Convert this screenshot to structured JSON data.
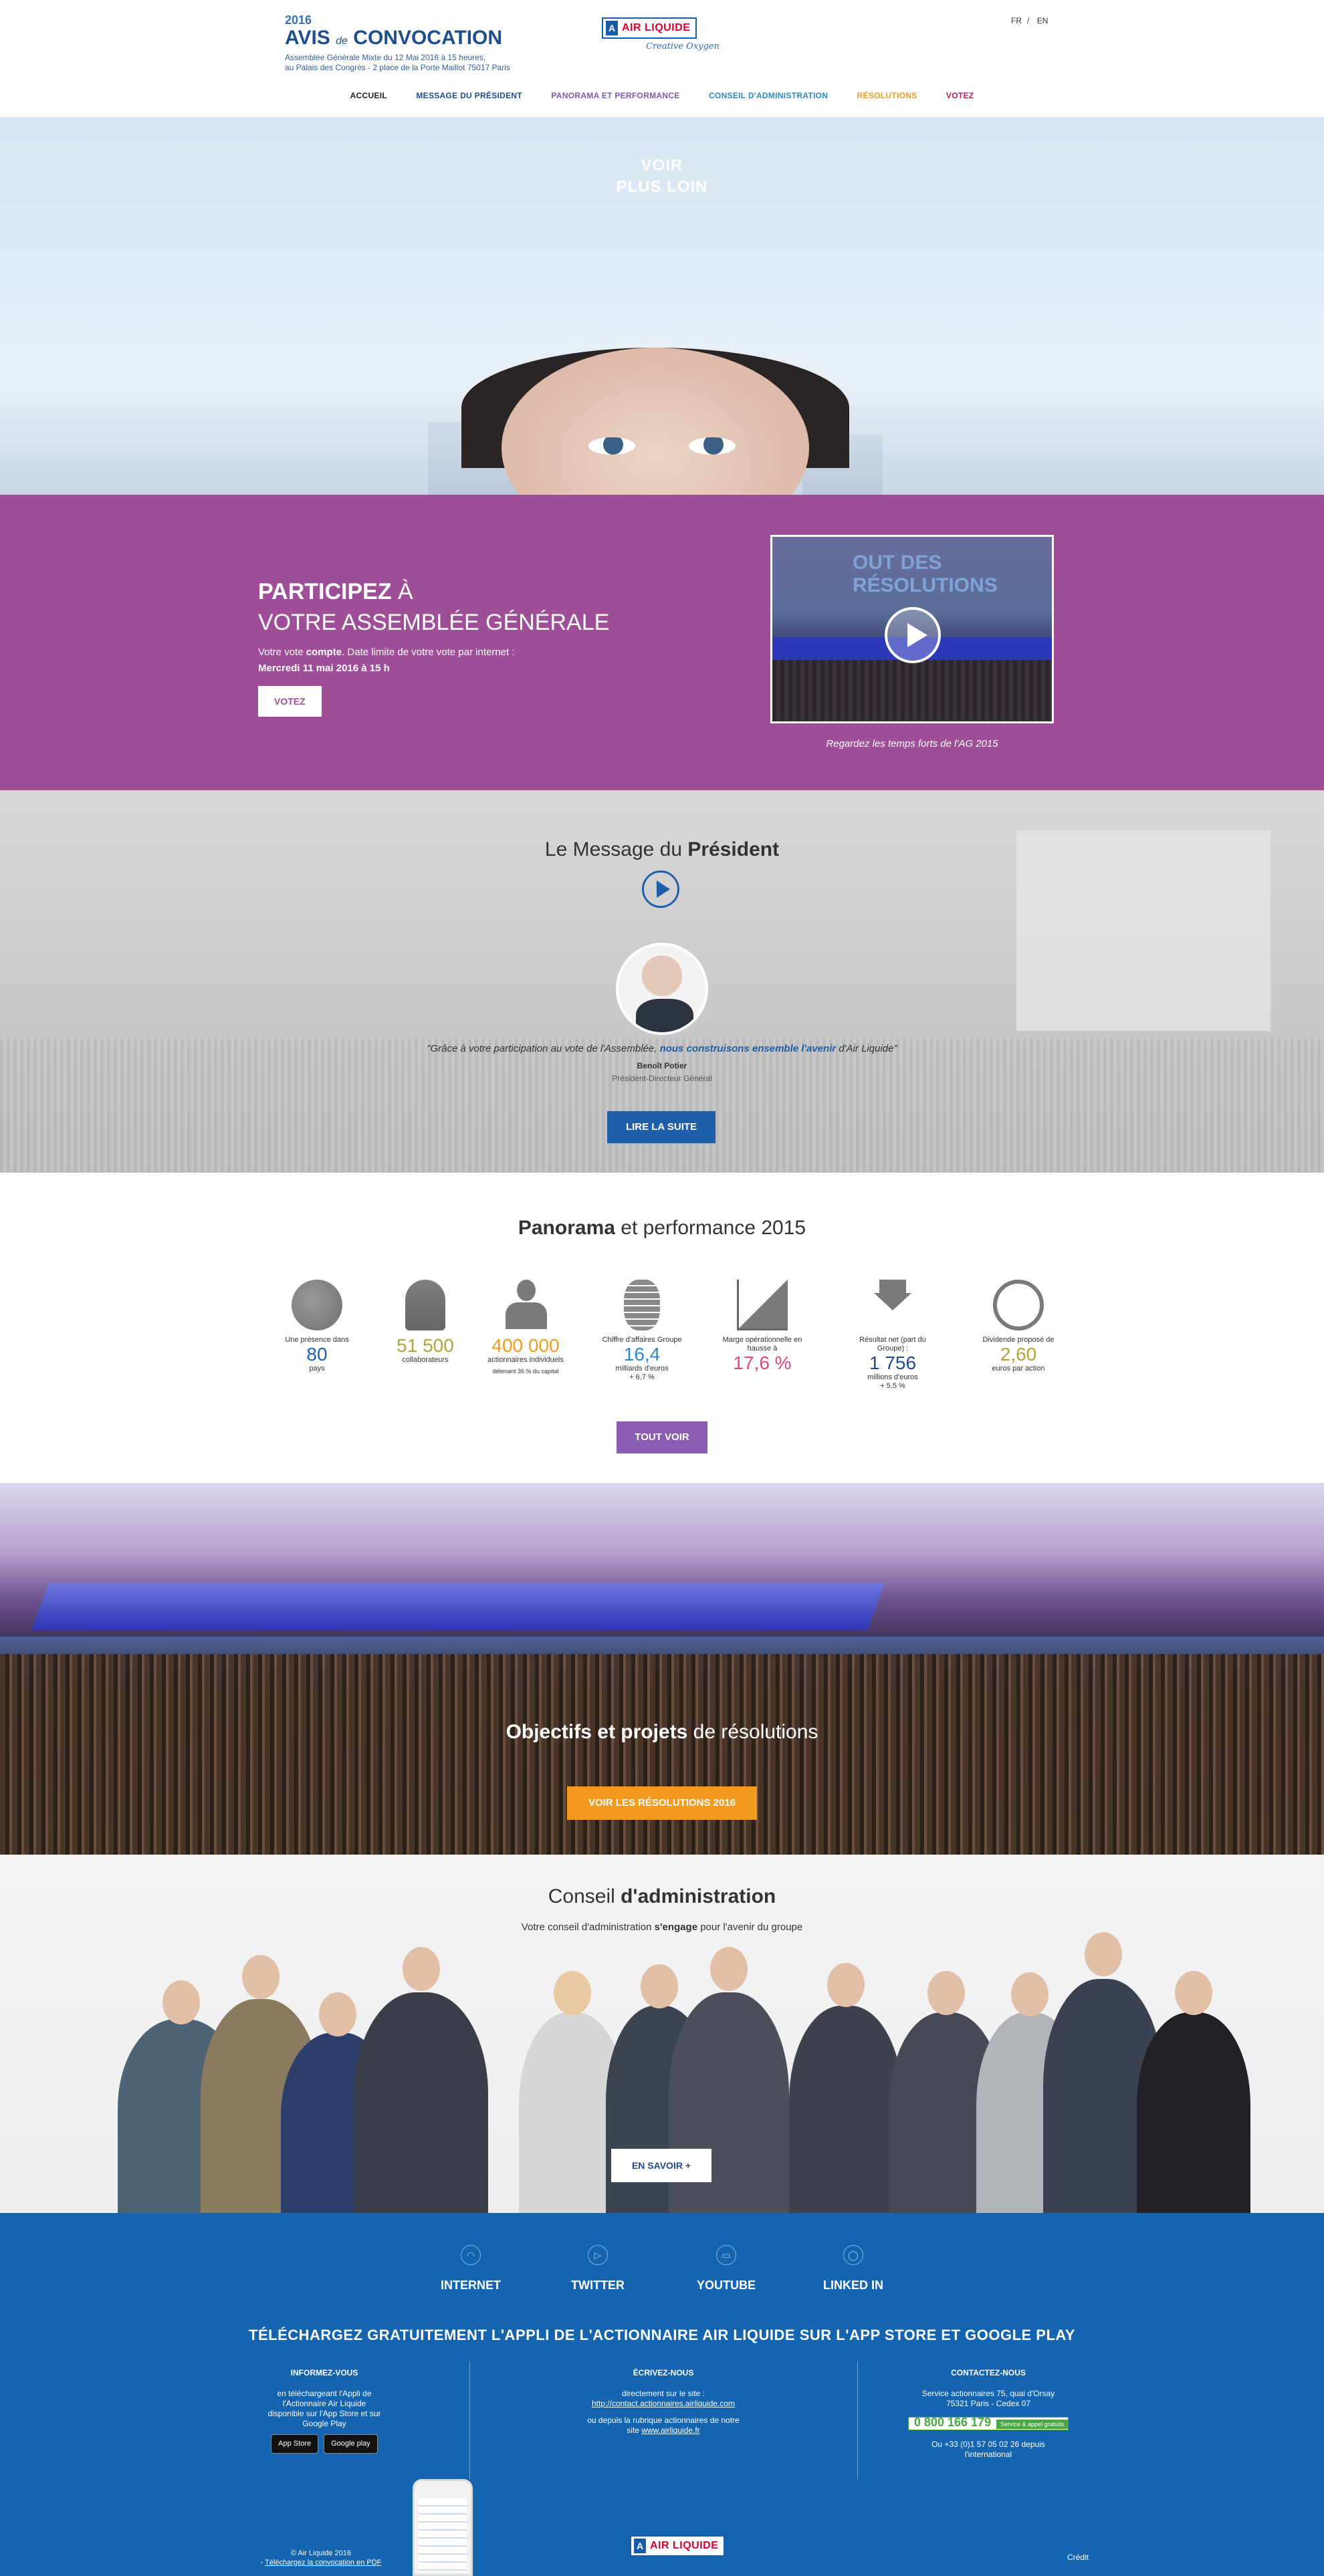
{
  "header": {
    "year": "2016",
    "title_a": "AVIS",
    "title_de": "de",
    "title_b": "CONVOCATION",
    "sub1": "Assemblée Générale Mixte du 12 Mai 2016 à 15 heures,",
    "sub2": "au Palais des Congrès - 2 place de la Porte Maillot 75017 Paris",
    "logo_mark": "A",
    "logo_text": "AIR LIQUIDE",
    "logo_tag": "Creative Oxygen",
    "lang_fr": "FR",
    "lang_sep": "/",
    "lang_en": "EN"
  },
  "nav": [
    {
      "label": "ACCUEIL",
      "color": "#222222"
    },
    {
      "label": "MESSAGE DU PRÉSIDENT",
      "color": "#1f4b8e"
    },
    {
      "label": "PANORAMA ET PERFORMANCE",
      "color": "#7e57b0"
    },
    {
      "label": "CONSEIL D'ADMINISTRATION",
      "color": "#2f86c9"
    },
    {
      "label": "RÉSOLUTIONS",
      "color": "#f39b1e"
    },
    {
      "label": "VOTEZ",
      "color": "#c2185b"
    }
  ],
  "hero": {
    "line1": "VOIR",
    "line2": "PLUS LOIN"
  },
  "participez": {
    "title_bold": "PARTICIPEZ",
    "title_rest": " À",
    "title_line2": "VOTRE ASSEMBLÉE GÉNÉRALE",
    "text_a": "Votre vote ",
    "text_bold": "compte",
    "text_b": ". Date limite de votre vote par internet :",
    "date": "Mercredi 11 mai 2016 à 15 h",
    "button": "VOTEZ",
    "video_title": "OUT DES RÉSOLUTIONS",
    "video_caption": "Regardez les temps forts de l'AG 2015"
  },
  "president": {
    "title_a": "Le Message du ",
    "title_b": "Président",
    "quote_a": "\"Grâce à votre participation au vote de l'Assemblée, ",
    "quote_b": "nous construisons ensemble l'avenir",
    "quote_c": " d'Air Liquide\"",
    "name": "Benoît Potier",
    "role": "Président-Directeur Général",
    "button": "LIRE LA SUITE"
  },
  "panorama": {
    "title_a": "Panorama",
    "title_b": " et performance 2015",
    "button": "TOUT VOIR",
    "stats": [
      {
        "icon": "globe-icon",
        "pre": "Une présence dans",
        "value": "80",
        "post": "pays",
        "note": "",
        "color": "#1f5ea8"
      },
      {
        "icon": "helmet-icon",
        "pre": "",
        "value": "51 500",
        "post": "collaborateurs",
        "note": "",
        "color": "#b2a33a"
      },
      {
        "icon": "shareholder-icon",
        "pre": "",
        "value": "400 000",
        "post": "actionnaires individuels",
        "note": "détenant 36 % du capital",
        "color": "#f39b1e"
      },
      {
        "icon": "coins-icon",
        "pre": "Chiffre d'affaires Groupe",
        "value": "16,4",
        "post": "milliards d'euros",
        "note": "+ 6,7 %",
        "color": "#2f86c9"
      },
      {
        "icon": "growth-chart-icon",
        "pre": "Marge opérationnelle en hausse à",
        "value": "17,6 %",
        "post": "",
        "note": "",
        "color": "#e0457b"
      },
      {
        "icon": "download-icon",
        "pre": "Résultat net (part du Groupe) :",
        "value": "1 756",
        "post": "millions d'euros",
        "note": "+ 5,5 %",
        "color": "#1f4b8e"
      },
      {
        "icon": "pie-chart-icon",
        "pre": "Dividende proposé de",
        "value": "2,60",
        "post": "euros par action",
        "note": "",
        "color": "#b2a33a"
      }
    ]
  },
  "resolutions": {
    "title_a": "Objectifs et projets",
    "title_b": " de résolutions",
    "button": "VOIR LES RÉSOLUTIONS 2016"
  },
  "conseil": {
    "title_a": "Conseil ",
    "title_b": "d'administration",
    "sub_a": "Votre conseil d'administration ",
    "sub_b": "s'engage",
    "sub_c": " pour l'avenir du groupe",
    "button": "EN SAVOIR +"
  },
  "footer": {
    "social": [
      {
        "label": "INTERNET",
        "icon": "wifi-icon",
        "glyph": "◠"
      },
      {
        "label": "TWITTER",
        "icon": "twitter-icon",
        "glyph": "▷"
      },
      {
        "label": "YOUTUBE",
        "icon": "youtube-icon",
        "glyph": "▭"
      },
      {
        "label": "LINKED IN",
        "icon": "linkedin-icon",
        "glyph": "◯"
      }
    ],
    "app_title": "TÉLÉCHARGEZ GRATUITEMENT L'APPLI DE L'ACTIONNAIRE AIR LIQUIDE SUR L'APP STORE ET GOOGLE PLAY",
    "col1_title": "INFORMEZ-VOUS",
    "col1_text1": "en téléchargeant l'Appli de",
    "col1_text2": "l'Actionnaire Air Liquide",
    "col1_text3": "disponible sur l'App Store et sur",
    "col1_text4": "Google Play",
    "appstore": "App Store",
    "googleplay": "Google play",
    "col2_title": "ÉCRIVEZ-NOUS",
    "col2_text1": "directement sur le site :",
    "col2_link1": "http://contact.actionnaires.airliquide.com",
    "col2_text2": "ou depuis la rubrique actionnaires de notre",
    "col2_text3": "site ",
    "col2_link2": "www.airliquide.fr",
    "col3_title": "CONTACTEZ-NOUS",
    "col3_text1": "Service actionnaires 75, quai d'Orsay",
    "col3_text2": "75321 Paris - Cedex 07",
    "phone": "0 800 166 179",
    "phone_note": "Service & appel gratuits",
    "col3_text3": "Ou +33 (0)1 57 05 02 26 depuis",
    "col3_text4": "l'international",
    "copyright": "© Air Liquide 2016",
    "pdf_prefix": "- ",
    "pdf_link": "Téléchargez la convocation en PDF",
    "credit": "Crédit"
  }
}
